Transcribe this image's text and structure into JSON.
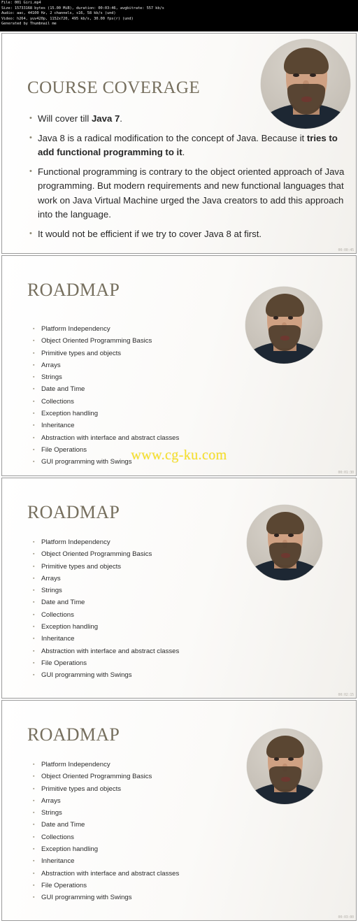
{
  "meta_header": {
    "lines": [
      "File: 001 Giri.mp4",
      "Size: 15733168 bytes (15.00 MiB), duration: 00:03:46, avgbitrate: 557 kb/s",
      "Audio: aac, 44100 Hz, 2 channels, s16, 58 kb/s (und)",
      "Video: h264, yuv420p, 1152x720, 495 kb/s, 30.00 fps(r) (und)",
      "Generated by Thumbnail me"
    ]
  },
  "watermark": {
    "text": "www.cg-ku.com",
    "color": "#f7e02a"
  },
  "theme": {
    "title_color": "#766f5e",
    "bullet_color": "#8d8873",
    "body_color": "#262626",
    "frame_border": "#9a9a9a"
  },
  "thumbnails": [
    {
      "index": 1,
      "timestamp": "00:00:45",
      "slide": {
        "title": "COURSE COVERAGE",
        "kind": "course-coverage",
        "bullets": [
          {
            "parts": [
              {
                "text": "Will cover till ",
                "bold": false
              },
              {
                "text": "Java 7",
                "bold": true
              },
              {
                "text": ".",
                "bold": false
              }
            ]
          },
          {
            "parts": [
              {
                "text": "Java 8 is a radical modification to the concept of Java. Because it ",
                "bold": false
              },
              {
                "text": "tries to add functional programming to it",
                "bold": true
              },
              {
                "text": ".",
                "bold": false
              }
            ]
          },
          {
            "parts": [
              {
                "text": "Functional programming is contrary to the object oriented approach of Java programming. But modern requirements and new functional languages that work on Java Virtual Machine urged the Java creators to add this approach into the language.",
                "bold": false
              }
            ]
          },
          {
            "parts": [
              {
                "text": "It would not be efficient if we try to cover Java 8 at first.",
                "bold": false
              }
            ]
          }
        ]
      },
      "webcam": {
        "present": true,
        "shape": "circle",
        "subject": "instructor"
      }
    },
    {
      "index": 2,
      "timestamp": "00:01:30",
      "slide": {
        "title": "ROADMAP",
        "kind": "roadmap",
        "items": [
          "Platform Independency",
          "Object Oriented Programming Basics",
          "Primitive types and objects",
          "Arrays",
          "Strings",
          "Date and Time",
          "Collections",
          "Exception handling",
          "Inheritance",
          "Abstraction with interface and abstract classes",
          "File Operations",
          "GUI programming with Swings"
        ]
      },
      "webcam": {
        "present": true,
        "shape": "circle",
        "subject": "instructor"
      }
    },
    {
      "index": 3,
      "timestamp": "00:02:15",
      "slide": {
        "title": "ROADMAP",
        "kind": "roadmap",
        "items": [
          "Platform Independency",
          "Object Oriented Programming Basics",
          "Primitive types and objects",
          "Arrays",
          "Strings",
          "Date and Time",
          "Collections",
          "Exception handling",
          "Inheritance",
          "Abstraction with interface and abstract classes",
          "File Operations",
          "GUI programming with Swings"
        ]
      },
      "webcam": {
        "present": true,
        "shape": "circle",
        "subject": "instructor"
      }
    },
    {
      "index": 4,
      "timestamp": "00:03:00",
      "slide": {
        "title": "ROADMAP",
        "kind": "roadmap",
        "items": [
          "Platform Independency",
          "Object Oriented Programming Basics",
          "Primitive types and objects",
          "Arrays",
          "Strings",
          "Date and Time",
          "Collections",
          "Exception handling",
          "Inheritance",
          "Abstraction with interface and abstract classes",
          "File Operations",
          "GUI programming with Swings"
        ]
      },
      "webcam": {
        "present": true,
        "shape": "circle",
        "subject": "instructor"
      }
    }
  ]
}
